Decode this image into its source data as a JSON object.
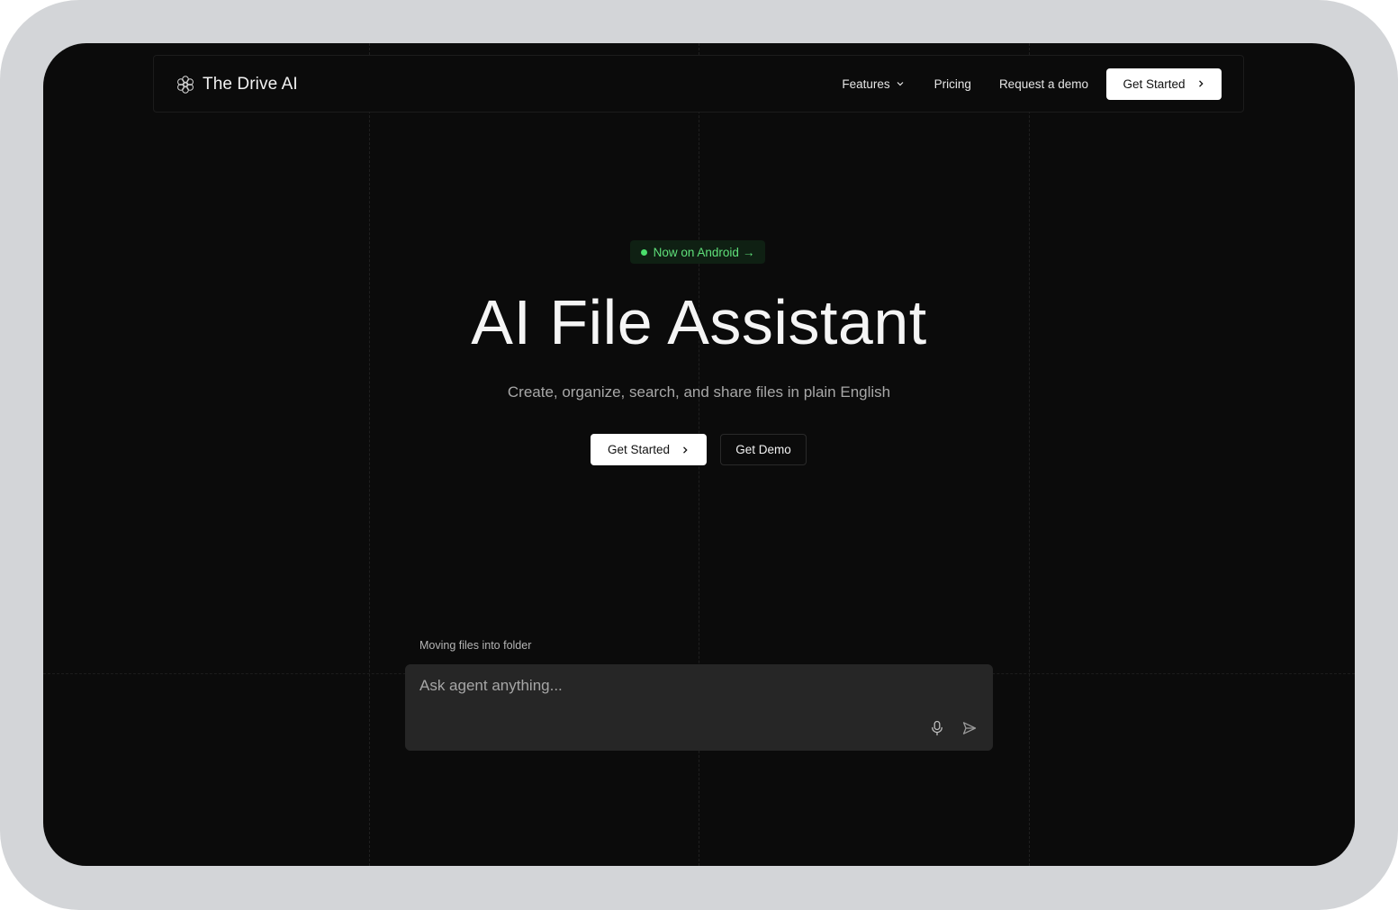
{
  "nav": {
    "brand": "The Drive AI",
    "links": {
      "features": "Features",
      "pricing": "Pricing",
      "request_demo": "Request a demo"
    },
    "cta": "Get Started"
  },
  "hero": {
    "badge": "Now on Android",
    "badge_arrow": "→",
    "title": "AI File Assistant",
    "subtitle": "Create, organize, search, and share files in plain English",
    "primary_cta": "Get Started",
    "secondary_cta": "Get Demo"
  },
  "agent": {
    "status": "Moving files into folder",
    "placeholder": "Ask agent anything..."
  },
  "icons": {
    "logo": "flower-logo-icon",
    "features_dropdown": "chevron-down-icon",
    "cta_arrow": "chevron-right-icon",
    "mic": "microphone-icon",
    "send": "send-icon"
  },
  "colors": {
    "background": "#0b0b0b",
    "badge_text": "#5fe07a",
    "badge_bg": "#0f2013",
    "button_bg": "#ffffff",
    "input_bg": "#262626"
  }
}
